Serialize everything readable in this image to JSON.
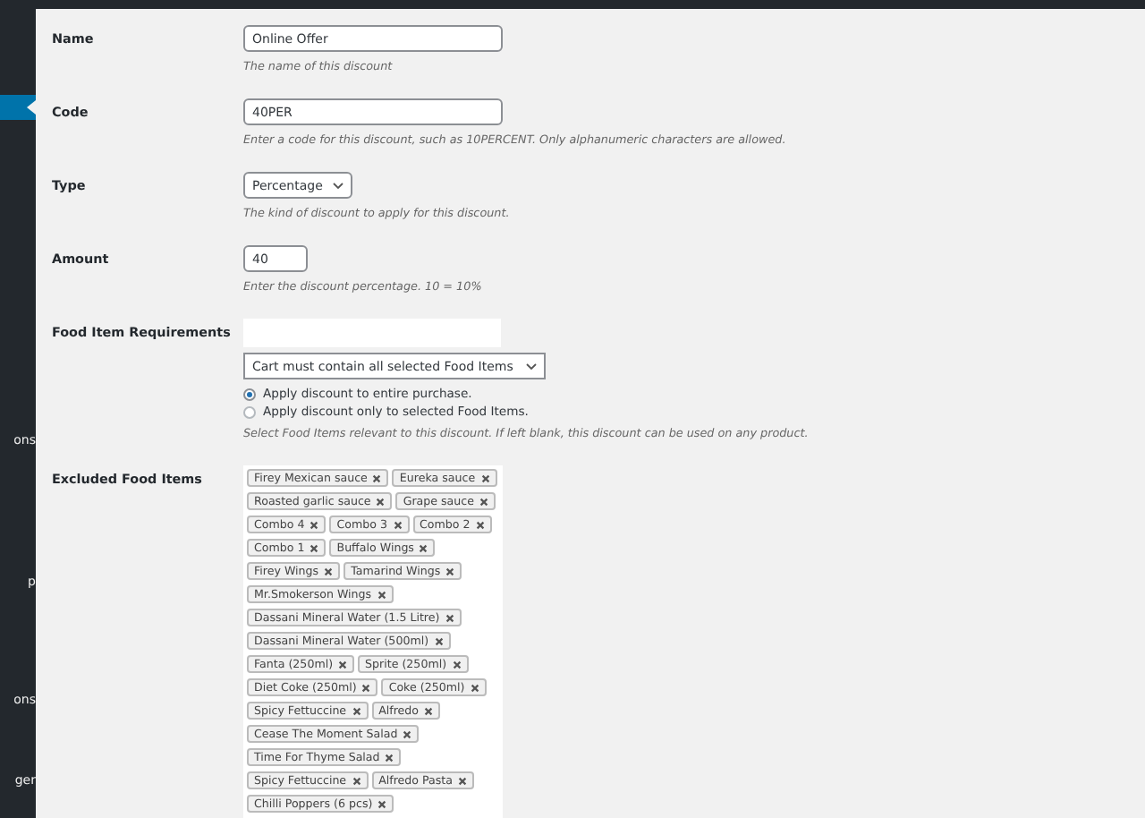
{
  "sidebar": {
    "items": [
      {
        "selected": true
      },
      {
        "label": "ons",
        "selected": false
      },
      {
        "label": "p",
        "selected": false
      },
      {
        "label": "ons",
        "selected": false
      },
      {
        "label": "ger",
        "selected": false
      }
    ]
  },
  "fields": [
    {
      "kind": "text",
      "label": "Name",
      "value": "Online Offer",
      "description": "The name of this discount"
    },
    {
      "kind": "text",
      "label": "Code",
      "value": "40PER",
      "description": "Enter a code for this discount, such as 10PERCENT. Only alphanumeric characters are allowed."
    },
    {
      "kind": "select",
      "label": "Type",
      "value": "Percentage",
      "description": "The kind of discount to apply for this discount."
    },
    {
      "kind": "number",
      "label": "Amount",
      "value": "40",
      "description": "Enter the discount percentage. 10 = 10%"
    },
    {
      "kind": "requirements",
      "label": "Food Item Requirements",
      "select": "Cart must contain all selected Food Items",
      "options": [
        {
          "label": "Apply discount to entire purchase.",
          "selected": true
        },
        {
          "label": "Apply discount only to selected Food Items.",
          "selected": false
        }
      ],
      "description": "Select Food Items relevant to this discount. If left blank, this discount can be used on any product."
    },
    {
      "kind": "tags",
      "label": "Excluded Food Items",
      "tags": [
        "Firey Mexican sauce",
        "Eureka sauce",
        "Roasted garlic sauce",
        "Grape sauce",
        "Combo 4",
        "Combo 3",
        "Combo 2",
        "Combo 1",
        "Buffalo Wings",
        "Firey Wings",
        "Tamarind Wings",
        "Mr.Smokerson Wings",
        "Dassani Mineral Water (1.5 Litre)",
        "Dassani Mineral Water (500ml)",
        "Fanta (250ml)",
        "Sprite (250ml)",
        "Diet Coke (250ml)",
        "Coke (250ml)",
        "Spicy Fettuccine",
        "Alfredo",
        "Cease The Moment Salad",
        "Time For Thyme Salad",
        "Spicy Fettuccine",
        "Alfredo Pasta",
        "Chilli Poppers (6 pcs)"
      ]
    }
  ]
}
